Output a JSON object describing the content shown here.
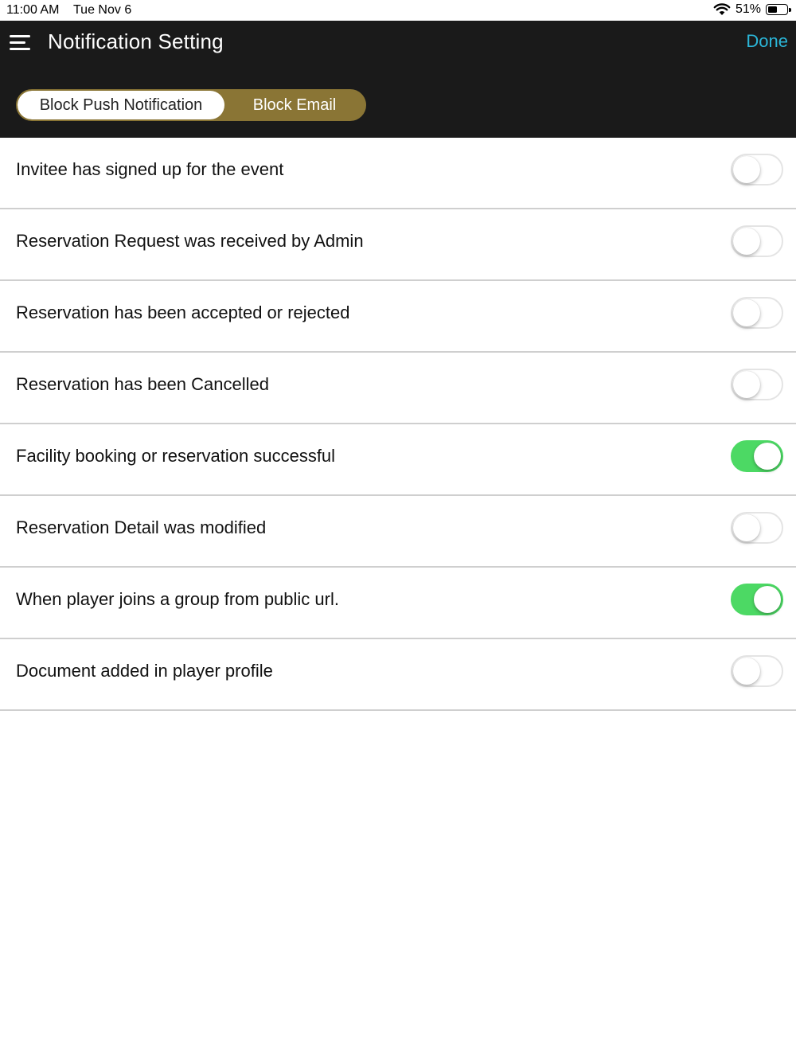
{
  "status_bar": {
    "time": "11:00 AM",
    "date": "Tue Nov 6",
    "battery_percent": "51%",
    "battery_level": 0.51,
    "wifi_icon": "wifi-icon",
    "battery_icon": "battery-icon"
  },
  "header": {
    "menu_icon": "menu-icon",
    "title": "Notification Setting",
    "done_label": "Done",
    "done_color": "#2bb6d8",
    "background": "#1a1a1a"
  },
  "segmented": {
    "accent_color": "#8a7535",
    "selected_index": 0,
    "items": [
      {
        "label": "Block Push Notification"
      },
      {
        "label": "Block Email"
      }
    ]
  },
  "settings": {
    "toggle_on_color": "#4cd964",
    "items": [
      {
        "label": "Invitee has signed up for the event",
        "enabled": false
      },
      {
        "label": "Reservation Request was received by Admin",
        "enabled": false
      },
      {
        "label": "Reservation has been accepted or rejected",
        "enabled": false
      },
      {
        "label": "Reservation has been Cancelled",
        "enabled": false
      },
      {
        "label": "Facility booking or reservation successful",
        "enabled": true
      },
      {
        "label": "Reservation Detail was modified",
        "enabled": false
      },
      {
        "label": "When player joins a group from public url.",
        "enabled": true
      },
      {
        "label": "Document added in player profile",
        "enabled": false
      }
    ]
  }
}
